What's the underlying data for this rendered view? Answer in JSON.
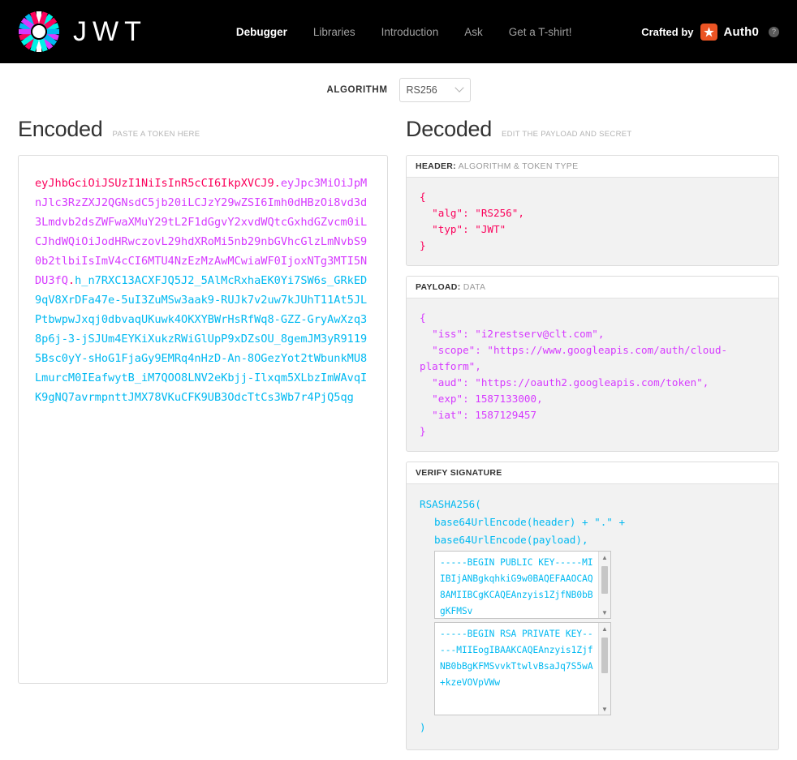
{
  "nav": {
    "brand_word": "JWT",
    "logo_icon": "jwt-starburst-logo",
    "links": [
      {
        "label": "Debugger",
        "active": true
      },
      {
        "label": "Libraries",
        "active": false
      },
      {
        "label": "Introduction",
        "active": false
      },
      {
        "label": "Ask",
        "active": false
      },
      {
        "label": "Get a T-shirt!",
        "active": false
      }
    ],
    "crafted_by": "Crafted by",
    "auth0_label": "Auth0",
    "auth0_icon": "auth0-badge-icon",
    "help_icon": "?"
  },
  "algorithm": {
    "label": "ALGORITHM",
    "value": "RS256",
    "chevron_icon": "chevron-down-icon"
  },
  "encoded": {
    "title": "Encoded",
    "subtitle": "PASTE A TOKEN HERE",
    "token_header": "eyJhbGciOiJSUzI1NiIsInR5cCI6IkpXVCJ9",
    "token_payload": "eyJpc3MiOiJpMnJlc3RzZXJ2QGNsdC5jb20iLCJzY29wZSI6Imh0dHBzOi8vd3d3Lmdvb2dsZWFwaXMuY29tL2F1dGgvY2xvdWQtcGxhdGZvcm0iLCJhdWQiOiJodHRwczovL29hdXRoMi5nb29nbGVhcGlzLmNvbS90b2tlbiIsImV4cCI6MTU4NzEzMzAwMCwiaWF0IjoxNTg3MTI5NDU3fQ",
    "token_signature": "h_n7RXC13ACXFJQ5J2_5AlMcRxhaEK0Yi7SW6s_GRkED9qV8XrDFa47e-5uI3ZuMSw3aak9-RUJk7v2uw7kJUhT11At5JLPtbwpwJxqj0dbvaqUKuwk4OKXYBWrHsRfWq8-GZZ-GryAwXzq38p6j-3-jSJUm4EYKiXukzRWiGlUpP9xDZsOU_8gemJM3yR91195Bsc0yY-sHoG1FjaGy9EMRq4nHzD-An-8OGezYot2tWbunkMU8LmurcM0IEafwytB_iM7QOO8LNV2eKbjj-Ilxqm5XLbzImWAvqIK9gNQ7avrmpnttJMX78VKuCFK9UB3OdcTtCs3Wb7r4PjQ5qg",
    "separator": "."
  },
  "decoded": {
    "title": "Decoded",
    "subtitle": "EDIT THE PAYLOAD AND SECRET",
    "header_panel": {
      "label_strong": "HEADER:",
      "label_light": "ALGORITHM & TOKEN TYPE",
      "json": "{\n  \"alg\": \"RS256\",\n  \"typ\": \"JWT\"\n}"
    },
    "payload_panel": {
      "label_strong": "PAYLOAD:",
      "label_light": "DATA",
      "json": "{\n  \"iss\": \"i2restserv@clt.com\",\n  \"scope\": \"https://www.googleapis.com/auth/cloud-platform\",\n  \"aud\": \"https://oauth2.googleapis.com/token\",\n  \"exp\": 1587133000,\n  \"iat\": 1587129457\n}"
    },
    "signature_panel": {
      "label_strong": "VERIFY SIGNATURE",
      "line1": "RSASHA256(",
      "line2": "base64UrlEncode(header) + \".\" +",
      "line3": "base64UrlEncode(payload),",
      "public_key": "-----BEGIN PUBLIC KEY-----MIIBIjANBgkqhkiG9w0BAQEFAAOCAQ8AMIIBCgKCAQEAnzyis1ZjfNB0bBgKFMSv",
      "private_key": "-----BEGIN RSA PRIVATE KEY-----MIIEogIBAAKCAQEAnzyis1ZjfNB0bBgKFMSvvkTtwlvBsaJq7S5wA+kzeVOVpVWw",
      "closing": ")"
    }
  }
}
